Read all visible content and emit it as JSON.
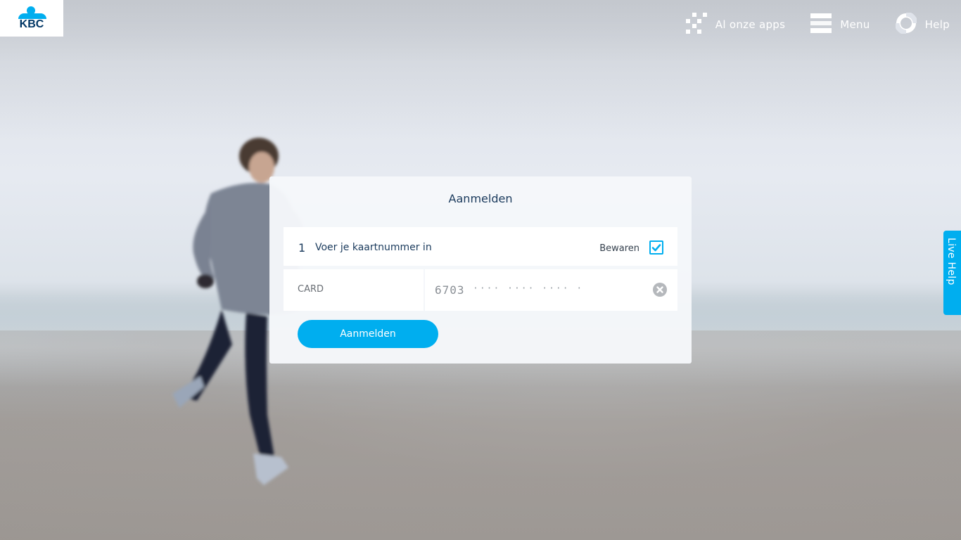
{
  "brand": {
    "logo_text": "KBC",
    "accent_color": "#00aeef",
    "navy_color": "#003665"
  },
  "header": {
    "apps_label": "Al onze apps",
    "menu_label": "Menu",
    "help_label": "Help"
  },
  "login": {
    "title": "Aanmelden",
    "step_number": "1",
    "step_label": "Voer je kaartnummer in",
    "keep_label": "Bewaren",
    "keep_checked": true,
    "card_label": "CARD",
    "card_value": "6703",
    "card_mask": "····  ····  ····  ·",
    "submit_label": "Aanmelden"
  },
  "live_help": {
    "label": "Live Help"
  },
  "icons": {
    "apps": "grid-icon",
    "menu": "hamburger-icon",
    "help": "lifebuoy-icon",
    "checkbox": "checkmark-icon",
    "clear": "clear-x-icon"
  }
}
